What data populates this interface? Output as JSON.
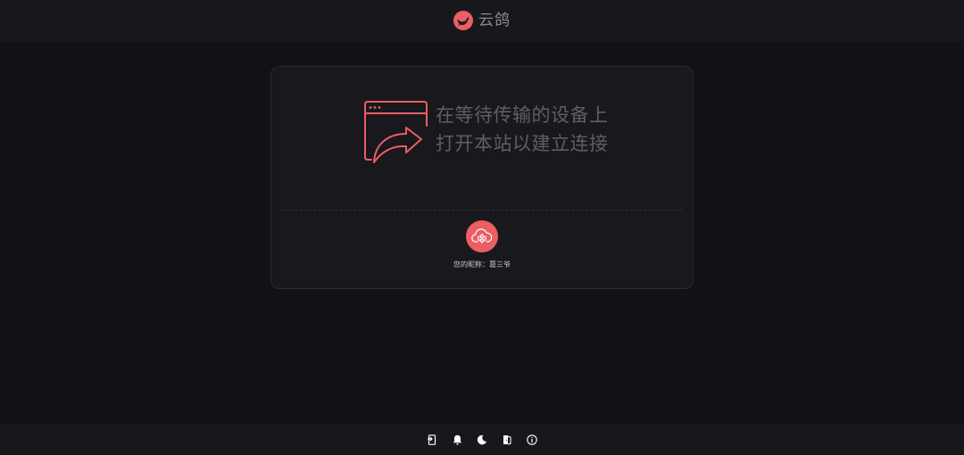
{
  "header": {
    "title": "云鸽",
    "logo_icon": "pigeon-logo-icon",
    "brand_color": "#ea5e64"
  },
  "card": {
    "illustration_icon": "browser-share-arrow-icon",
    "hint_line1": "在等待传输的设备上",
    "hint_line2": "打开本站以建立连接",
    "avatar_icon": "cloud-device-icon",
    "nickname_text": "您的昵称：葛三爷"
  },
  "footer": {
    "buttons": [
      {
        "name": "device-icon"
      },
      {
        "name": "bell-icon"
      },
      {
        "name": "moon-icon"
      },
      {
        "name": "door-icon"
      },
      {
        "name": "info-icon"
      }
    ]
  },
  "colors": {
    "accent": "#ea5e64",
    "background": "#121115",
    "card": "#19181c",
    "hint_text": "#5f5f63"
  }
}
